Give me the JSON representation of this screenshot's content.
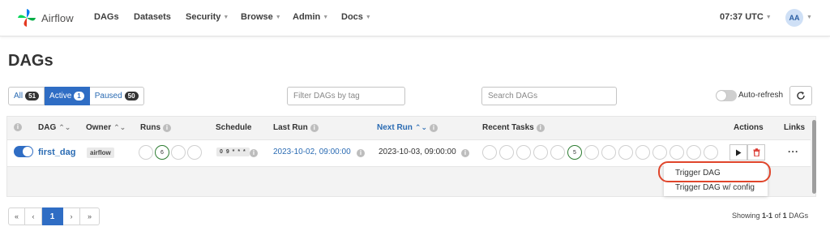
{
  "navbar": {
    "brand": "Airflow",
    "items": [
      {
        "label": "DAGs",
        "caret": false
      },
      {
        "label": "Datasets",
        "caret": false
      },
      {
        "label": "Security",
        "caret": true
      },
      {
        "label": "Browse",
        "caret": true
      },
      {
        "label": "Admin",
        "caret": true
      },
      {
        "label": "Docs",
        "caret": true
      }
    ],
    "time": "07:37 UTC",
    "avatar": "AA"
  },
  "page": {
    "title": "DAGs"
  },
  "filters": {
    "status": [
      {
        "label": "All",
        "count": "51",
        "active": false
      },
      {
        "label": "Active",
        "count": "1",
        "active": true
      },
      {
        "label": "Paused",
        "count": "50",
        "active": false
      }
    ],
    "tag_placeholder": "Filter DAGs by tag",
    "search_placeholder": "Search DAGs",
    "auto_refresh_label": "Auto-refresh"
  },
  "table": {
    "columns": {
      "dag": "DAG",
      "owner": "Owner",
      "runs": "Runs",
      "schedule": "Schedule",
      "last_run": "Last Run",
      "next_run": "Next Run",
      "recent_tasks": "Recent Tasks",
      "actions": "Actions",
      "links": "Links"
    },
    "rows": [
      {
        "dag_id": "first_dag",
        "owner": "airflow",
        "runs_success": "6",
        "schedule": "0 9 * * *",
        "last_run": "2023-10-02, 09:00:00",
        "next_run": "2023-10-03, 09:00:00",
        "recent_tasks_success": "5"
      }
    ]
  },
  "dropdown": {
    "items": [
      "Trigger DAG",
      "Trigger DAG w/ config"
    ]
  },
  "pagination": {
    "first": "«",
    "prev": "‹",
    "current": "1",
    "next": "›",
    "last": "»",
    "showing_prefix": "Showing",
    "showing_range": "1-1",
    "showing_of": "of",
    "showing_total": "1",
    "showing_suffix": "DAGs"
  },
  "colors": {
    "primary": "#2f6dc4",
    "success": "#2e7d32",
    "danger": "#d9342b",
    "highlight": "#e0452b"
  }
}
